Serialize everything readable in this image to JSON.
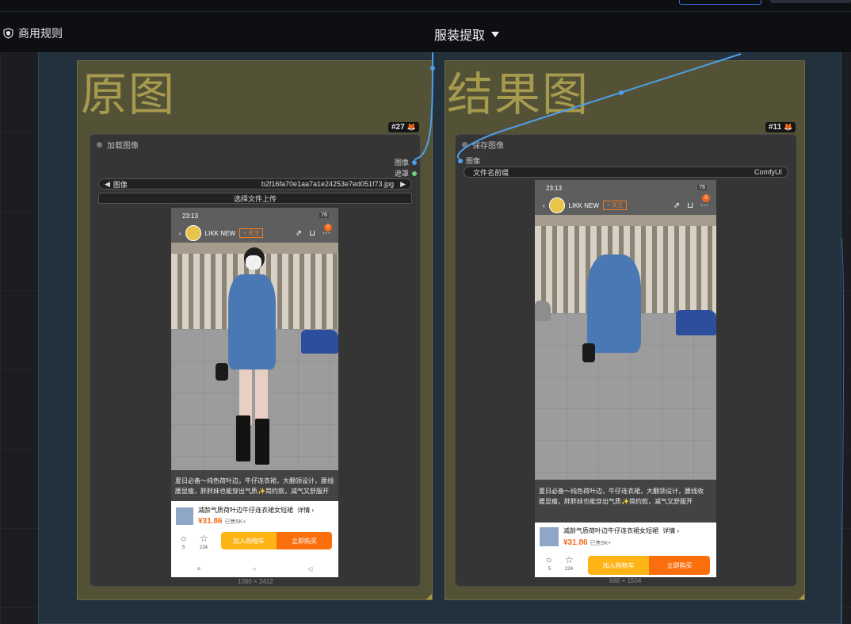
{
  "header": {
    "rules_label": "商用规则",
    "workflow_title": "服装提取"
  },
  "groups": {
    "left_title": "原图",
    "right_title": "结果图"
  },
  "load_node": {
    "badge": "#27",
    "title": "加载图像",
    "output_image": "图像",
    "output_mask": "遮罩",
    "image_label": "图像",
    "image_value": "b2f16fa70e1aa7a1e24253e7ed051f73.jpg",
    "upload_label": "选择文件上传",
    "dims": "1080 × 2412"
  },
  "save_node": {
    "badge": "#11",
    "title": "保存图像",
    "input_image": "图像",
    "prefix_label": "文件名前缀",
    "prefix_value": "ComfyUI",
    "dims": "688 × 1504"
  },
  "phone_left": {
    "time": "23:13",
    "battery": "76",
    "shop": "LIKK NEW",
    "follow": "+ 关注",
    "cart_count": "0",
    "caption_line1": "夏日必备～纯色荷叶边，牛仔连衣裙，大翻领设计，腰线收",
    "caption_line2": "腰显瘦，胖胖妹也能穿出气质✨简约款，减气又舒服开",
    "product_title": "减龄气质荷叶边牛仔连衣裙女短裙",
    "details": "详情 ›",
    "price": "¥31.86",
    "sold": "已售5K+",
    "comments": "5",
    "favorites": "224",
    "add_cart": "加入购物车",
    "buy_now": "立即购买"
  },
  "phone_right": {
    "time": "23:13",
    "battery": "76",
    "shop": "LIKK NEW",
    "follow": "+ 关注",
    "cart_count": "0",
    "caption_line1": "夏日必备～纯色荷叶边，牛仔连衣裙，大翻领设计，腰线收",
    "caption_line2": "腰显瘦，胖胖妹也能穿出气质✨简约款，减气又舒服开",
    "product_title": "减龄气质荷叶边牛仔连衣裙女短裙",
    "details": "详情 ›",
    "price": "¥31.86",
    "sold": "已售5K+",
    "comments": "5",
    "favorites": "224",
    "add_cart": "加入购物车",
    "buy_now": "立即购买"
  },
  "colors": {
    "wire_image": "#4f9ee8",
    "wire_mask": "#6ed07a",
    "group_fill": "#545236",
    "group_title": "#a69a4e"
  }
}
